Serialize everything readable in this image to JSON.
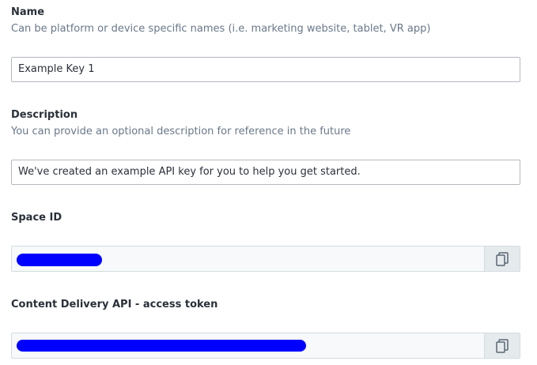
{
  "name": {
    "label": "Name",
    "hint": "Can be platform or device specific names (i.e. marketing website, tablet, VR app)",
    "value": "Example Key 1"
  },
  "description": {
    "label": "Description",
    "hint": "You can provide an optional description for reference in the future",
    "value": "We've created an example API key for you to help you get started."
  },
  "space_id": {
    "label": "Space ID",
    "copy_icon": "copy-icon"
  },
  "cda_token": {
    "label": "Content Delivery API - access token",
    "copy_icon": "copy-icon"
  },
  "colors": {
    "redaction": "#0000ff",
    "label": "#2a3039",
    "hint": "#6a7889",
    "readonly_bg": "#f7f9fa",
    "copy_btn_bg": "#e5ebed"
  }
}
